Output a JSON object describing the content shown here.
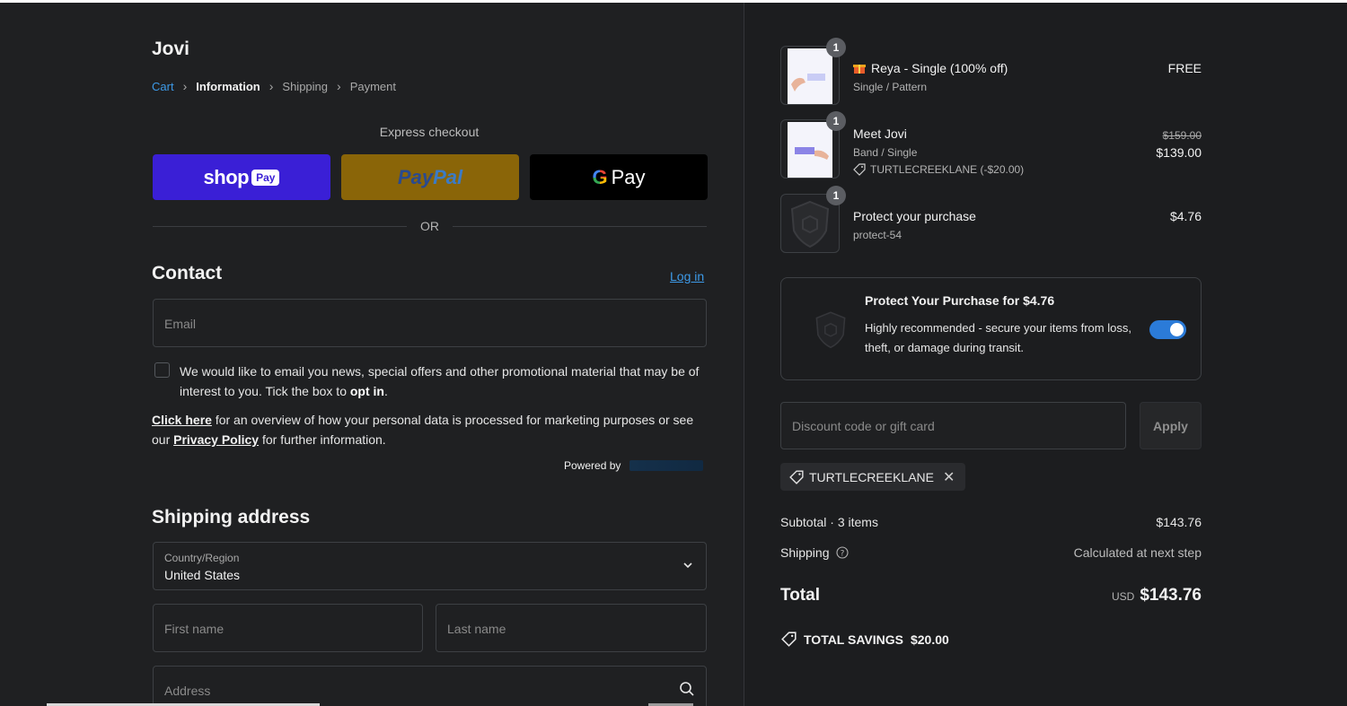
{
  "store": {
    "name": "Jovi"
  },
  "breadcrumb": {
    "items": [
      {
        "label": "Cart"
      },
      {
        "label": "Information"
      },
      {
        "label": "Shipping"
      },
      {
        "label": "Payment"
      }
    ]
  },
  "express": {
    "label": "Express checkout",
    "shop_word": "shop",
    "shop_pill": "Pay",
    "paypal_pay": "Pay",
    "paypal_pal": "Pal",
    "gpay_g": "G",
    "gpay_word": "Pay",
    "or": "OR"
  },
  "contact": {
    "heading": "Contact",
    "login": "Log in",
    "email_placeholder": "Email",
    "optin_text": "We would like to email you news, special offers and other promotional material that may be of interest to you. Tick the box to ",
    "optin_bold": "opt in",
    "optin_end": ".",
    "privacy_link1": "Click here",
    "privacy_mid": " for an overview of how your personal data is processed for marketing purposes or see our ",
    "privacy_link2": "Privacy Policy",
    "privacy_end": " for further information.",
    "powered_by": "Powered by"
  },
  "shipping": {
    "heading": "Shipping address",
    "country_label": "Country/Region",
    "country_value": "United States",
    "first_name_placeholder": "First name",
    "last_name_placeholder": "Last name",
    "address_placeholder": "Address"
  },
  "order": {
    "items": [
      {
        "qty": "1",
        "name": "Reya - Single (100% off)",
        "variant": "Single / Pattern",
        "price": "FREE"
      },
      {
        "qty": "1",
        "name": "Meet Jovi",
        "variant": "Band / Single",
        "discount": "TURTLECREEKLANE (-$20.00)",
        "original_price": "$159.00",
        "price": "$139.00"
      },
      {
        "qty": "1",
        "name": "Protect your purchase",
        "variant": "protect-54",
        "price": "$4.76"
      }
    ],
    "protect": {
      "title": "Protect Your Purchase for $4.76",
      "description": "Highly recommended - secure your items from loss, theft, or damage during transit.",
      "enabled": true
    },
    "discount": {
      "placeholder": "Discount code or gift card",
      "apply": "Apply",
      "applied_code": "TURTLECREEKLANE"
    },
    "subtotal_label": "Subtotal · 3 items",
    "subtotal_value": "$143.76",
    "shipping_label": "Shipping",
    "shipping_value": "Calculated at next step",
    "total_label": "Total",
    "total_currency": "USD",
    "total_value": "$143.76",
    "savings_label": "TOTAL SAVINGS",
    "savings_value": "$20.00"
  },
  "colors": {
    "accent_link": "#3d9ae8",
    "shop_pay": "#3a1fd6",
    "paypal": "#8a6508",
    "toggle_on": "#2b7bd8"
  }
}
